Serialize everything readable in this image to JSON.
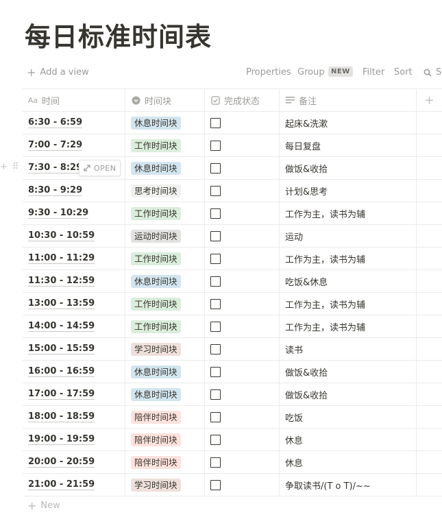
{
  "page": {
    "title": "每日标准时间表"
  },
  "toolbar": {
    "add_view": "Add a view",
    "properties": "Properties",
    "group": "Group",
    "new_badge": "NEW",
    "filter": "Filter",
    "sort": "Sort",
    "search_partial": "S"
  },
  "columns": [
    {
      "label": "时间",
      "icon": "text-aa-icon"
    },
    {
      "label": "时间块",
      "icon": "select-icon"
    },
    {
      "label": "完成状态",
      "icon": "checkbox-icon"
    },
    {
      "label": "备注",
      "icon": "lines-icon"
    }
  ],
  "hover": {
    "open_label": "OPEN"
  },
  "tag_colors": {
    "休息时间块": "#d3e5ef",
    "工作时间块": "#dbeddb",
    "思考时间块": "#f1f1ef",
    "运动时间块": "#e3e2e0",
    "学习时间块": "#eee0da",
    "陪伴时间块": "#ffe2dd"
  },
  "rows": [
    {
      "time": "6:30 - 6:59",
      "block": "休息时间块",
      "done": false,
      "note": "起床&洗漱"
    },
    {
      "time": "7:00 - 7:29",
      "block": "工作时间块",
      "done": false,
      "note": "每日复盘"
    },
    {
      "time": "7:30 - 8:29",
      "block": "休息时间块",
      "done": false,
      "note": "做饭&收拾"
    },
    {
      "time": "8:30 - 9:29",
      "block": "思考时间块",
      "done": false,
      "note": "计划&思考"
    },
    {
      "time": "9:30 - 10:29",
      "block": "工作时间块",
      "done": false,
      "note": "工作为主，读书为辅"
    },
    {
      "time": "10:30 - 10:59",
      "block": "运动时间块",
      "done": false,
      "note": "运动"
    },
    {
      "time": "11:00 - 11:29",
      "block": "工作时间块",
      "done": false,
      "note": "工作为主，读书为辅"
    },
    {
      "time": "11:30 - 12:59",
      "block": "休息时间块",
      "done": false,
      "note": "吃饭&休息"
    },
    {
      "time": "13:00 - 13:59",
      "block": "工作时间块",
      "done": false,
      "note": "工作为主，读书为辅"
    },
    {
      "time": "14:00 - 14:59",
      "block": "工作时间块",
      "done": false,
      "note": "工作为主，读书为辅"
    },
    {
      "time": "15:00 - 15:59",
      "block": "学习时间块",
      "done": false,
      "note": "读书"
    },
    {
      "time": "16:00 - 16:59",
      "block": "休息时间块",
      "done": false,
      "note": "做饭&收拾"
    },
    {
      "time": "17:00 - 17:59",
      "block": "休息时间块",
      "done": false,
      "note": "做饭&收拾"
    },
    {
      "time": "18:00 - 18:59",
      "block": "陪伴时间块",
      "done": false,
      "note": "吃饭"
    },
    {
      "time": "19:00 - 19:59",
      "block": "陪伴时间块",
      "done": false,
      "note": "休息"
    },
    {
      "time": "20:00 - 20:59",
      "block": "陪伴时间块",
      "done": false,
      "note": "休息"
    },
    {
      "time": "21:00 - 21:59",
      "block": "学习时间块",
      "done": false,
      "note": "争取读书/(T o T)/~~"
    }
  ],
  "footer": {
    "new_label": "New"
  }
}
